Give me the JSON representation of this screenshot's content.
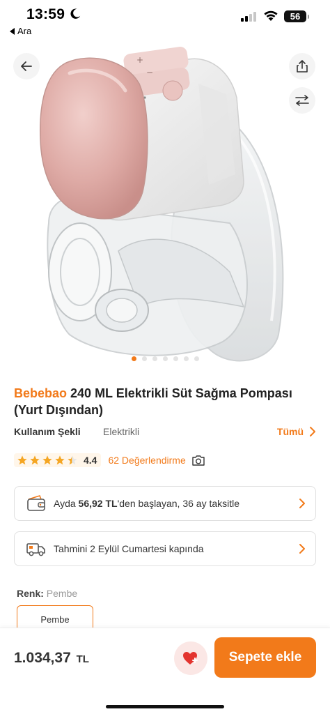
{
  "status_bar": {
    "time": "13:59",
    "back_app": "Ara",
    "battery": "56"
  },
  "hero": {
    "image_alt": "Elektrikli süt sağma pompası ürün görseli",
    "dots_count": 7,
    "active_dot": 0
  },
  "product": {
    "brand": "Bebebao",
    "name": " 240 ML Elektrikli Süt Sağma Pompası (Yurt Dışından)",
    "attribute": {
      "key": "Kullanım Şekli",
      "value": "Elektrikli",
      "all_label": "Tümü"
    },
    "rating": {
      "score": "4.4",
      "stars": 4.4,
      "reviews": "62 Değerlendirme"
    }
  },
  "installment": {
    "prefix": "Ayda ",
    "amount": "56,92 TL",
    "suffix": "'den başlayan, 36 ay taksitle"
  },
  "delivery": {
    "text": "Tahmini 2 Eylül Cumartesi kapında"
  },
  "color": {
    "label": "Renk:",
    "value": "Pembe",
    "option": "Pembe"
  },
  "bottom": {
    "price": "1.034,37",
    "currency": "TL",
    "cart_label": "Sepete ekle"
  },
  "colors": {
    "accent": "#f27a1a",
    "fav_bg": "#fbe7e5",
    "heart": "#e3342f",
    "star": "#f5a623"
  }
}
